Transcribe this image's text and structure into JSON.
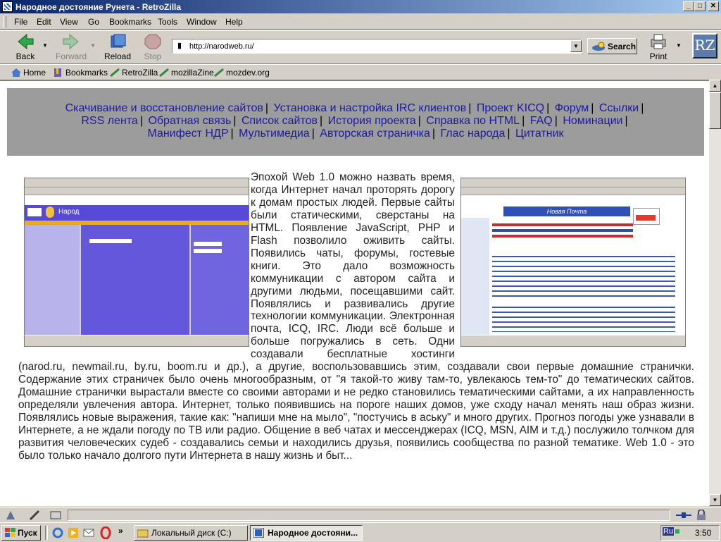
{
  "window": {
    "title": "Народное достояние Рунета - RetroZilla",
    "controls": {
      "minimize": "_",
      "maximize": "□",
      "close": "✕"
    }
  },
  "menu": {
    "items": [
      "File",
      "Edit",
      "View",
      "Go",
      "Bookmarks",
      "Tools",
      "Window",
      "Help"
    ]
  },
  "toolbar": {
    "back": "Back",
    "forward": "Forward",
    "reload": "Reload",
    "stop": "Stop",
    "print": "Print",
    "search": "Search",
    "logo": "RZ"
  },
  "address": {
    "url": "http://narodweb.ru/"
  },
  "personal_bar": {
    "items": [
      "Home",
      "Bookmarks",
      "RetroZilla",
      "mozillaZine",
      "mozdev.org"
    ]
  },
  "nav_links": [
    "Скачивание и восстановление сайтов",
    "Установка и настройка IRC клиентов",
    "Проект KICQ",
    "Форум",
    "Ссылки",
    "RSS лента",
    "Обратная связь",
    "Список сайтов",
    "История проекта",
    "Справка по HTML",
    "FAQ",
    "Номинации",
    "Манифест НДР",
    "Мультимедиа",
    "Авторская страничка",
    "Глас народа",
    "Цитатник"
  ],
  "screenshots": {
    "left": {
      "site": "Народ"
    },
    "right": {
      "site": "Новая Почта"
    }
  },
  "article": {
    "text": "Эпохой Web 1.0 можно назвать время, когда Интернет начал проторять дорогу к домам простых людей. Первые сайты были статическими, сверстаны на HTML. Появление JavaScript, PHP и Flash позволило оживить сайты. Появились чаты, форумы, гостевые книги. Это дало возможность коммуникации с автором сайта и другими людьми, посещавшими сайт. Появлялись и развивались другие технологии коммуникации. Электронная почта, ICQ, IRC. Люди всё больше и больше погружались в сеть. Одни создавали бесплатные хостинги (narod.ru, newmail.ru, by.ru, boom.ru и др.), а другие, воспользовавшись этим, создавали свои первые домашние странички. Содержание этих страничек было очень многообразным, от \"я такой-то живу там-то, увлекаюсь тем-то\" до тематических сайтов. Домашние странички вырастали вместе со своими авторами и не редко становились тематическими сайтами, а их направленность определяли увлечения автора. Интернет, только появившись на пороге наших домов, уже сходу начал менять наш образ жизни. Появлялись новые выражения, такие как: \"напиши мне на мыло\", \"постучись в аську\" и много других. Прогноз погоды уже узнавали в Интернете, а не ждали погоду по ТВ или радио. Общение в веб чатах и мессенджерах (ICQ, MSN, AIM и т.д.) послужило толчком для развития человеческих судеб - создавались семьи и находились друзья, появились сообщества по разной тематике. Web 1.0 - это было только начало долгого пути Интернета в нашу жизнь и быт..."
  },
  "taskbar": {
    "start": "Пуск",
    "chevron": "»",
    "tasks": [
      "Локальный диск (C:)",
      "Народное достояни..."
    ],
    "lang": "Ru",
    "clock": "3:50"
  },
  "colors": {
    "title_start": "#0a246a",
    "title_end": "#a6caf0",
    "nav_bg": "#9c9c9c",
    "link": "#1a1aa6",
    "chrome": "#d4d0c8"
  }
}
